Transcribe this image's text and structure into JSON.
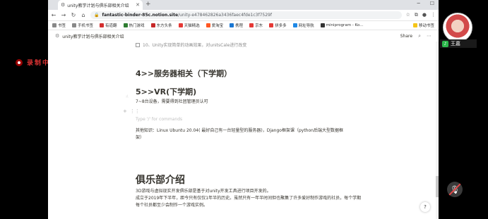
{
  "recording": {
    "label": "录制中"
  },
  "browser": {
    "tab_title": "unity教学计划与俱乐部相关介绍",
    "new_tab": "+",
    "url_host": "fantastic-binder-85c.notion.site",
    "url_path": "/unity-e478462826a3436faec4fde1c3f7529f",
    "bookmarks": [
      {
        "label": "书签",
        "color": "#888888"
      },
      {
        "label": "手机书签",
        "color": "#888888"
      },
      {
        "label": "有道翻",
        "color": "#d32f2f"
      },
      {
        "label": "热门游戏",
        "color": "#2e7d32"
      },
      {
        "label": "东方头条",
        "color": "#c62828"
      },
      {
        "label": "天猫精选",
        "color": "#e53935"
      },
      {
        "label": "爱淘宝",
        "color": "#ff5722"
      },
      {
        "label": "携程",
        "color": "#1976d2"
      },
      {
        "label": "京东",
        "color": "#e53935"
      },
      {
        "label": "拼多多",
        "color": "#e53935"
      },
      {
        "label": "网址导航",
        "color": "#1e88e5"
      },
      {
        "label": "miniprogram - Ko...",
        "color": "#333333"
      }
    ],
    "bookmarks_right": "移动书签"
  },
  "notion": {
    "breadcrumb": "unity教学计划与俱乐部相关介绍",
    "share": "Share",
    "todo_item": "10、Unity实现简单的动画效果，对unitsCale进行改变",
    "heading4": "4>>服务器相关（下学期）",
    "heading5": "5>>VR(下学期)",
    "heading5_para": "7~8台设备，需要得到社团管理员认可",
    "placeholder": "Type '/' for commands",
    "knowledge": "其他知识：Linux Ubuntu 20.04( 最好自己有一台轻量型的服务器)，Django框架课（python后端大型数据框架）",
    "club_heading": "俱乐部介绍",
    "club_p1": "3D游戏与虚拟现实开发俱乐部是基于对unity开发工具进行项目开发的。",
    "club_p2": "成立于2019年下半年，距今只有仅仅1年半的历史。虽然只有一年半时间但也聚集了许多爱好制作游戏的社员，每个学期每个社员都至少会制作一个游戏实例。",
    "help": "?"
  },
  "call": {
    "user_name": "王嘉"
  }
}
